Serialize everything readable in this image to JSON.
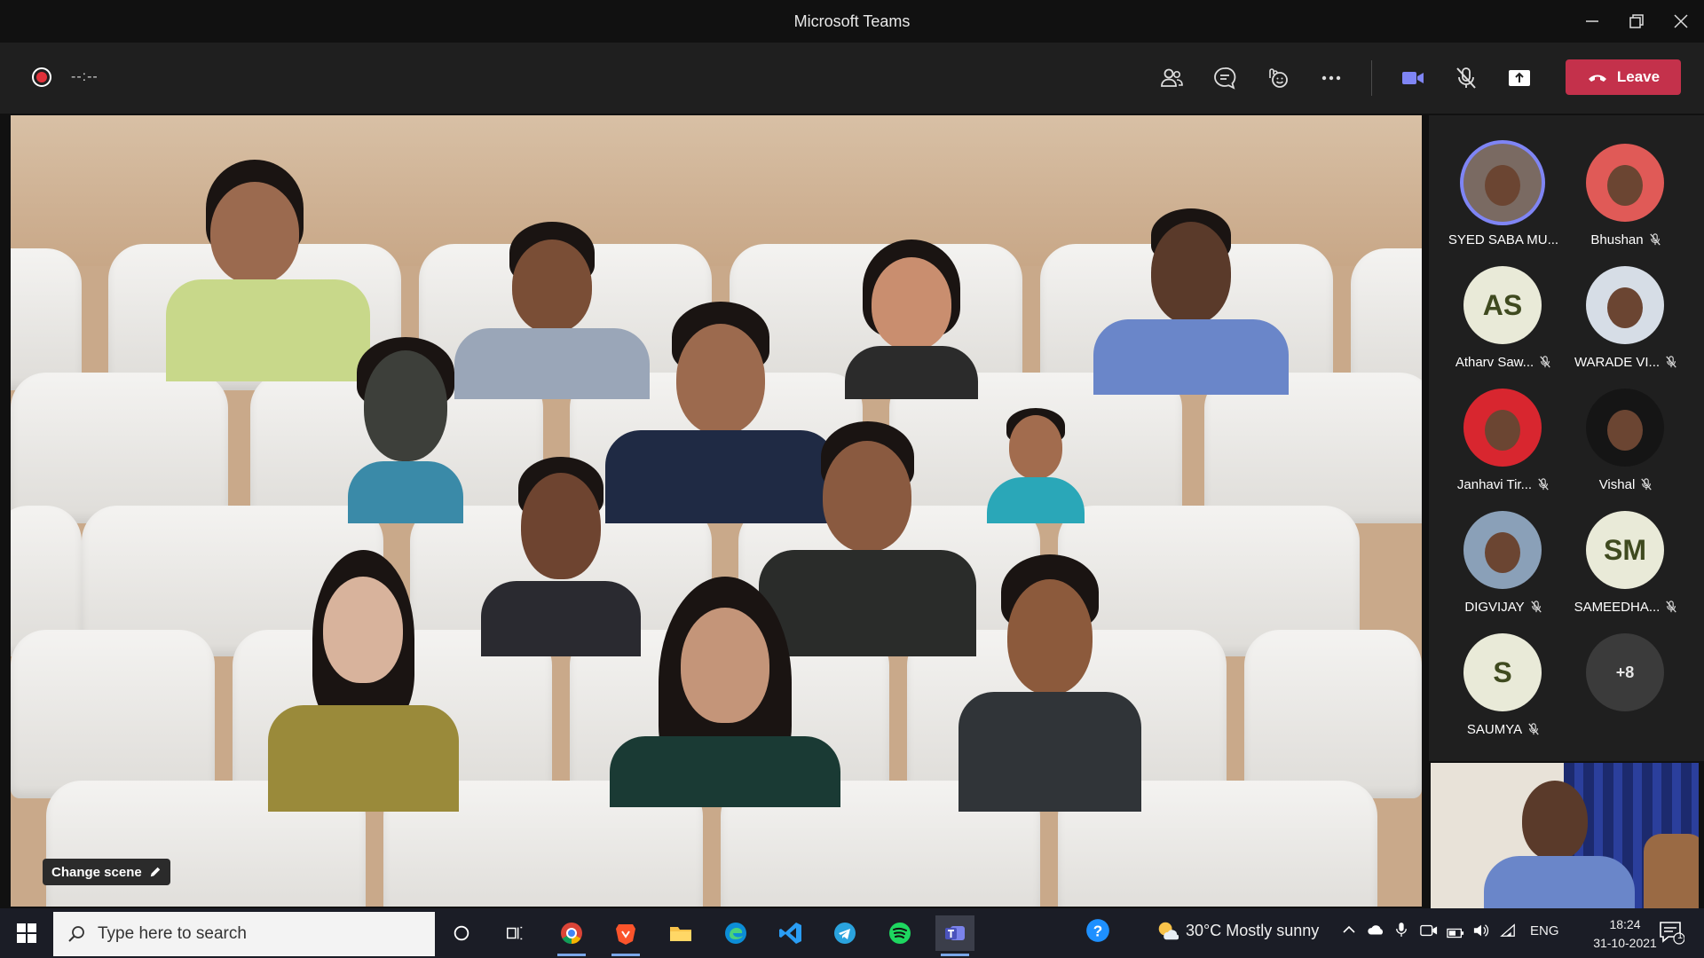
{
  "window": {
    "title": "Microsoft Teams"
  },
  "toolbar": {
    "timer": "--:--",
    "leave_label": "Leave",
    "icons": [
      "people-icon",
      "chat-icon",
      "reactions-icon",
      "more-icon",
      "camera-icon",
      "mic-muted-icon",
      "share-icon"
    ]
  },
  "stage": {
    "change_scene_label": "Change scene"
  },
  "roster": {
    "participants": [
      {
        "name": "SYED SABA MU...",
        "muted": false,
        "avatar": "photo",
        "active": true
      },
      {
        "name": "Bhushan",
        "muted": true,
        "avatar": "photo"
      },
      {
        "name": "Atharv Saw...",
        "muted": true,
        "avatar": "initials",
        "initials": "AS"
      },
      {
        "name": "WARADE VI...",
        "muted": true,
        "avatar": "photo"
      },
      {
        "name": "Janhavi Tir...",
        "muted": true,
        "avatar": "photo"
      },
      {
        "name": "Vishal",
        "muted": true,
        "avatar": "photo"
      },
      {
        "name": "DIGVIJAY",
        "muted": true,
        "avatar": "photo"
      },
      {
        "name": "SAMEEDHA...",
        "muted": true,
        "avatar": "initials",
        "initials": "SM"
      },
      {
        "name": "SAUMYA",
        "muted": true,
        "avatar": "initials",
        "initials": "S"
      }
    ],
    "overflow_label": "+8"
  },
  "taskbar": {
    "search_placeholder": "Type here to search",
    "weather": "30°C  Mostly sunny",
    "language": "ENG",
    "time": "18:24",
    "date": "31-10-2021",
    "notification_count": "1"
  },
  "colors": {
    "leave": "#c4314b",
    "accent": "#7f85f5",
    "toolbar": "#1f1f1f"
  }
}
